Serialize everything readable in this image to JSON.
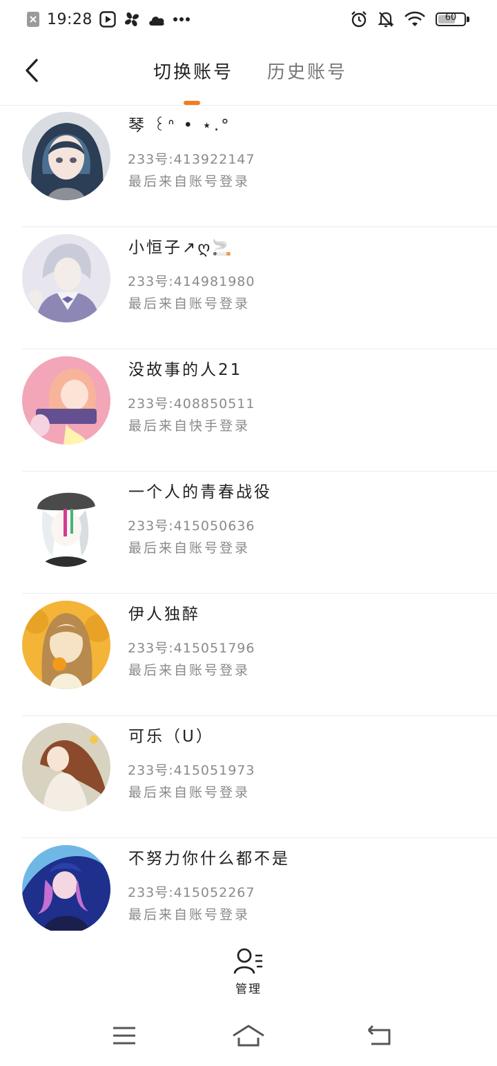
{
  "status_bar": {
    "time": "19:28",
    "left_icons": [
      "close-notification-icon",
      "media-play-icon",
      "fan-icon",
      "cloud-icon",
      "more-dots-icon"
    ],
    "right_icons": [
      "alarm-icon",
      "bell-off-icon",
      "wifi-icon",
      "battery-icon"
    ],
    "battery_level": "60"
  },
  "header": {
    "back_icon": "chevron-left-icon",
    "tabs": [
      {
        "label": "切换账号",
        "active": true
      },
      {
        "label": "历史账号",
        "active": false
      }
    ],
    "accent_color": "#f47b20"
  },
  "accounts": [
    {
      "name": "琴 ꒰ᐢ • ⋆.°",
      "id": "233号:413922147",
      "source": "最后来自账号登录"
    },
    {
      "name": "小恒子↗ღ🚬",
      "id": "233号:414981980",
      "source": "最后来自账号登录"
    },
    {
      "name": "没故事的人21",
      "id": "233号:408850511",
      "source": "最后来自快手登录"
    },
    {
      "name": "一个人的青春战役",
      "id": "233号:415050636",
      "source": "最后来自账号登录"
    },
    {
      "name": "伊人独醉",
      "id": "233号:415051796",
      "source": "最后来自账号登录"
    },
    {
      "name": "可乐（U）",
      "id": "233号:415051973",
      "source": "最后来自账号登录"
    },
    {
      "name": "不努力你什么都不是",
      "id": "233号:415052267",
      "source": "最后来自账号登录"
    }
  ],
  "manage": {
    "label": "管理",
    "icon": "user-list-icon"
  },
  "nav_bar": {
    "icons": [
      "menu-icon",
      "home-icon",
      "back-icon"
    ]
  }
}
